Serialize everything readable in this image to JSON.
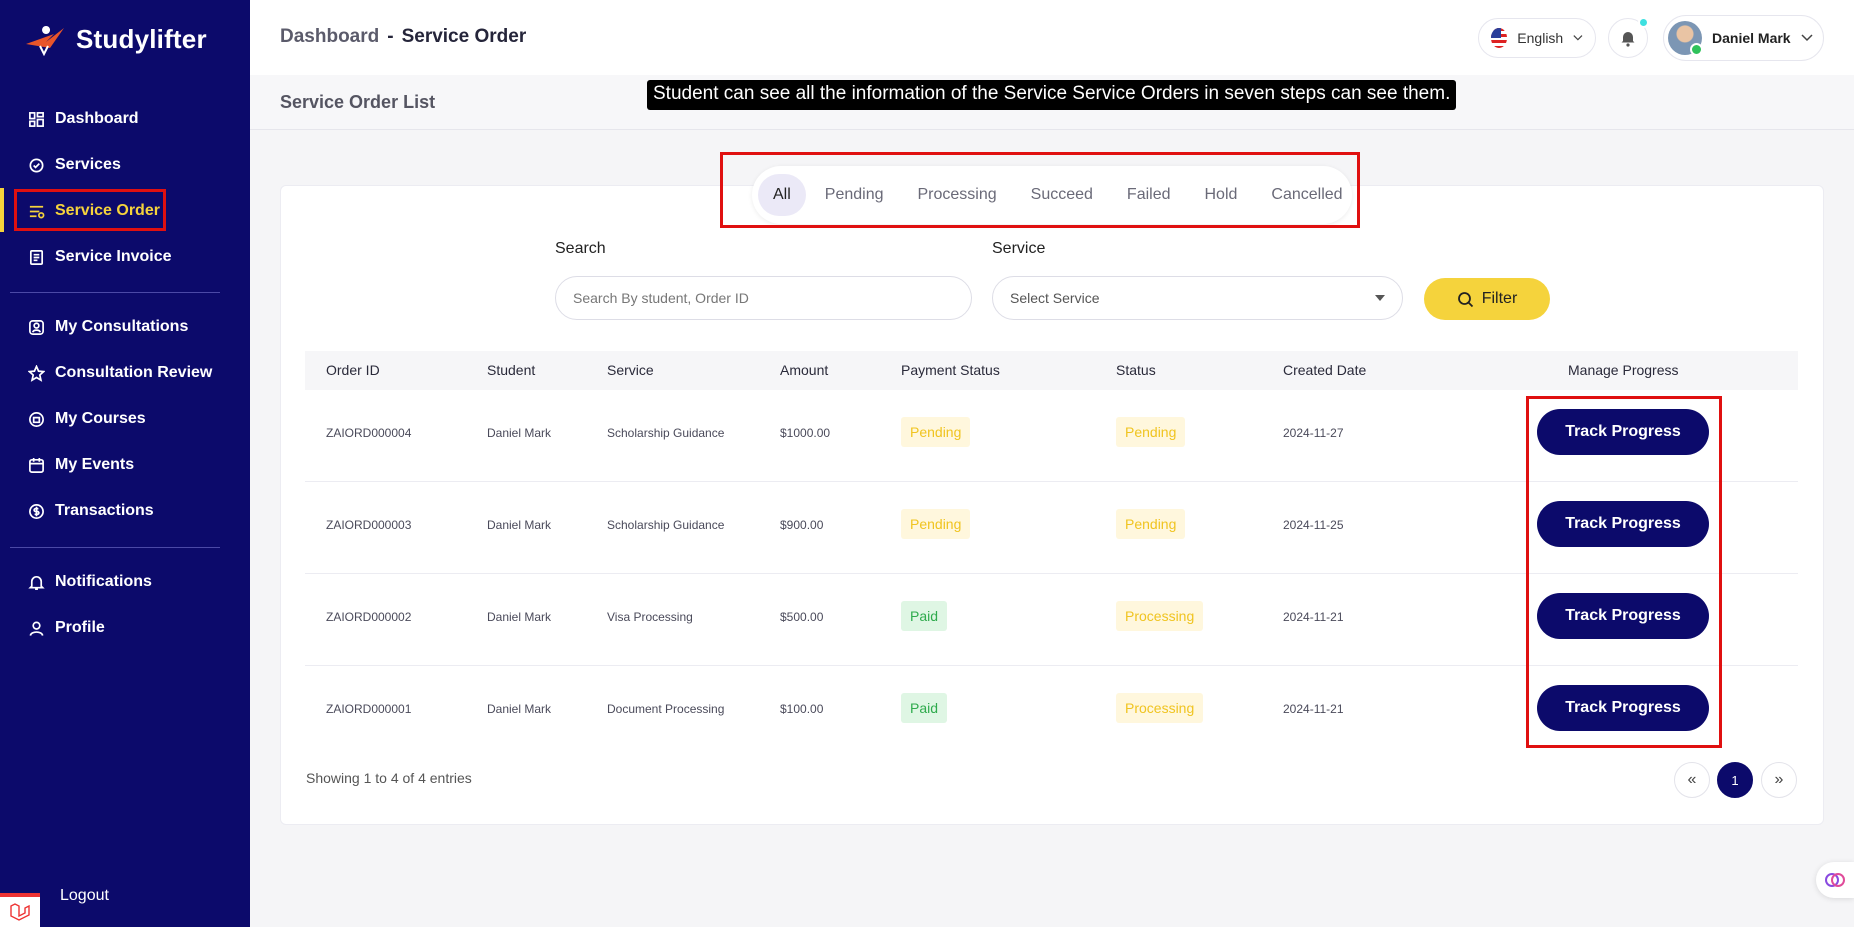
{
  "brand": {
    "name": "Studylifter"
  },
  "sidebar": {
    "items": [
      {
        "label": "Dashboard",
        "icon": "dashboard-icon"
      },
      {
        "label": "Services",
        "icon": "services-icon"
      },
      {
        "label": "Service Order",
        "icon": "order-icon",
        "active": true
      },
      {
        "label": "Service Invoice",
        "icon": "invoice-icon"
      },
      {
        "label": "My Consultations",
        "icon": "consultation-icon"
      },
      {
        "label": "Consultation Review",
        "icon": "star-icon"
      },
      {
        "label": "My Courses",
        "icon": "courses-icon"
      },
      {
        "label": "My Events",
        "icon": "calendar-icon"
      },
      {
        "label": "Transactions",
        "icon": "transactions-icon"
      },
      {
        "label": "Notifications",
        "icon": "bell-icon"
      },
      {
        "label": "Profile",
        "icon": "user-icon"
      }
    ],
    "logout": "Logout"
  },
  "header": {
    "breadcrumb_parent": "Dashboard",
    "breadcrumb_sep": "-",
    "breadcrumb_current": "Service Order",
    "language": "English",
    "user_name": "Daniel Mark"
  },
  "page": {
    "title": "Service Order List",
    "tooltip": "Student can see all the information of the Service Service Orders in seven steps can see them."
  },
  "tabs": [
    "All",
    "Pending",
    "Processing",
    "Succeed",
    "Failed",
    "Hold",
    "Cancelled"
  ],
  "filters": {
    "search_label": "Search",
    "search_placeholder": "Search By student, Order ID",
    "service_label": "Service",
    "service_selected": "Select Service",
    "filter_button": "Filter"
  },
  "table": {
    "columns": [
      "Order ID",
      "Student",
      "Service",
      "Amount",
      "Payment Status",
      "Status",
      "Created Date",
      "Manage Progress"
    ],
    "rows": [
      {
        "order_id": "ZAIORD000004",
        "student": "Daniel Mark",
        "service": "Scholarship Guidance",
        "amount": "$1000.00",
        "payment_status": "Pending",
        "status": "Pending",
        "created": "2024-11-27",
        "action": "Track Progress"
      },
      {
        "order_id": "ZAIORD000003",
        "student": "Daniel Mark",
        "service": "Scholarship Guidance",
        "amount": "$900.00",
        "payment_status": "Pending",
        "status": "Pending",
        "created": "2024-11-25",
        "action": "Track Progress"
      },
      {
        "order_id": "ZAIORD000002",
        "student": "Daniel Mark",
        "service": "Visa Processing",
        "amount": "$500.00",
        "payment_status": "Paid",
        "status": "Processing",
        "created": "2024-11-21",
        "action": "Track Progress"
      },
      {
        "order_id": "ZAIORD000001",
        "student": "Daniel Mark",
        "service": "Document Processing",
        "amount": "$100.00",
        "payment_status": "Paid",
        "status": "Processing",
        "created": "2024-11-21",
        "action": "Track Progress"
      }
    ]
  },
  "pagination": {
    "summary": "Showing 1 to 4 of 4 entries",
    "prev": "«",
    "current": "1",
    "next": "»"
  },
  "colors": {
    "sidebar_bg": "#0c0a6b",
    "accent": "#f5d33c",
    "highlight": "#e01010"
  }
}
